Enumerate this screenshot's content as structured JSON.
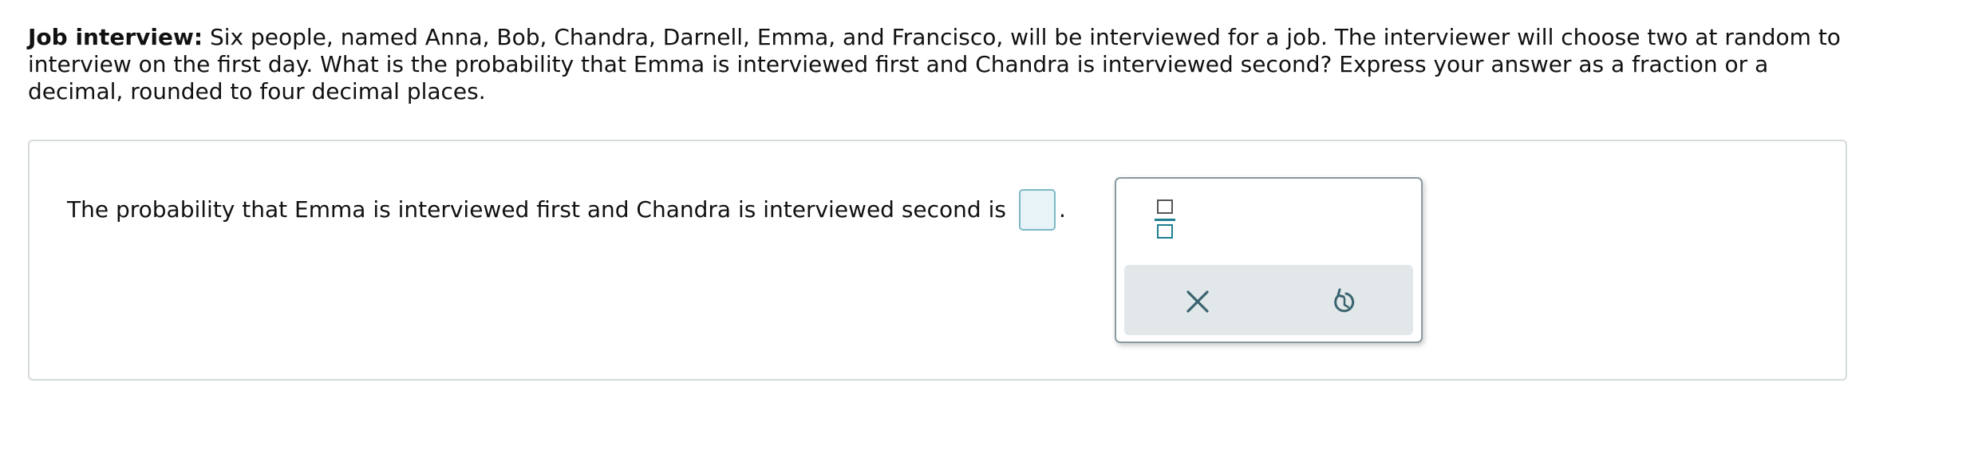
{
  "problem": {
    "lead": "Job interview:",
    "text": " Six people, named Anna, Bob, Chandra, Darnell, Emma, and Francisco, will be interviewed for a job. The interviewer will choose two at random to interview on the first day. What is the probability that Emma is interviewed first and Chandra is interviewed second? Express your answer as a fraction or a decimal, rounded to four decimal places."
  },
  "answer": {
    "sentence": "The probability that Emma is interviewed first and Chandra is interviewed second is",
    "value": "",
    "trailing": "."
  },
  "palette": {
    "buttons": [
      "fraction-icon",
      "clear-icon",
      "undo-icon"
    ]
  },
  "colors": {
    "accent": "#1f7f91",
    "input_fill": "#e7f3f7",
    "input_border": "#7db9c4",
    "control_bar": "#e2e8ea"
  }
}
